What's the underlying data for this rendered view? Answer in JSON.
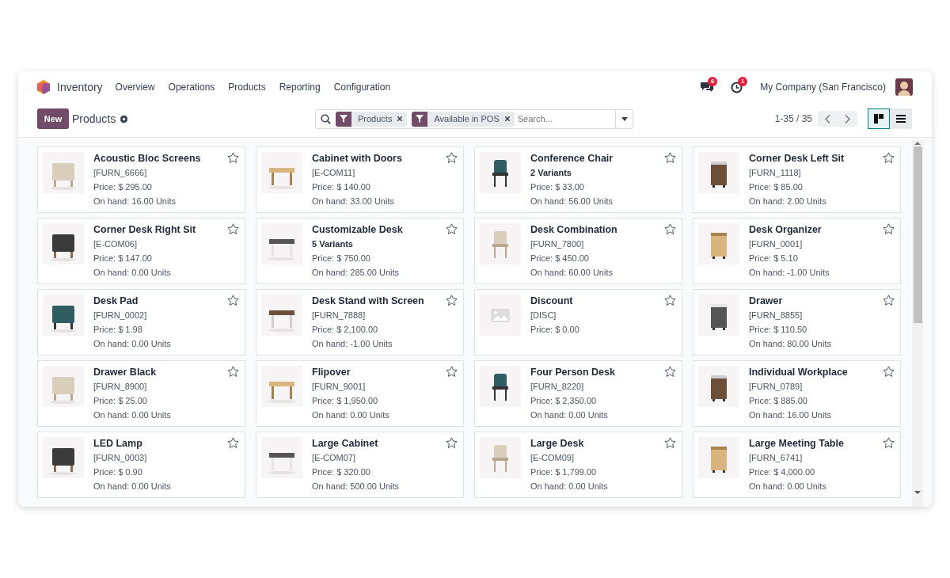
{
  "navbar": {
    "app_name": "Inventory",
    "menu": [
      "Overview",
      "Operations",
      "Products",
      "Reporting",
      "Configuration"
    ],
    "messages_count": "6",
    "activities_count": "1",
    "company": "My Company (San Francisco)"
  },
  "control_panel": {
    "new_button": "New",
    "title": "Products",
    "search": {
      "facets": [
        {
          "label": "Products"
        },
        {
          "label": "Available in POS"
        }
      ],
      "placeholder": "Search..."
    },
    "pager": "1-35 / 35",
    "views": [
      {
        "kind": "kanban",
        "selected": true
      },
      {
        "kind": "list",
        "selected": false
      }
    ]
  },
  "products": [
    {
      "name": "Acoustic Bloc Screens",
      "subtitle": {
        "kind": "reference",
        "text": "[FURN_6666]"
      },
      "price": "Price: $ 295.00",
      "on_hand": "On hand: 16.00 Units",
      "favorite": false
    },
    {
      "name": "Cabinet with Doors",
      "subtitle": {
        "kind": "reference",
        "text": "[E-COM11]"
      },
      "price": "Price: $ 140.00",
      "on_hand": "On hand: 33.00 Units",
      "favorite": false
    },
    {
      "name": "Conference Chair",
      "subtitle": {
        "kind": "variants",
        "text": "2 Variants"
      },
      "price": "Price: $ 33.00",
      "on_hand": "On hand: 56.00 Units",
      "favorite": false
    },
    {
      "name": "Corner Desk Left Sit",
      "subtitle": {
        "kind": "reference",
        "text": "[FURN_1118]"
      },
      "price": "Price: $ 85.00",
      "on_hand": "On hand: 2.00 Units",
      "favorite": false
    },
    {
      "name": "Corner Desk Right Sit",
      "subtitle": {
        "kind": "reference",
        "text": "[E-COM06]"
      },
      "price": "Price: $ 147.00",
      "on_hand": "On hand: 0.00 Units",
      "favorite": false
    },
    {
      "name": "Customizable Desk",
      "subtitle": {
        "kind": "variants",
        "text": "5 Variants"
      },
      "price": "Price: $ 750.00",
      "on_hand": "On hand: 285.00 Units",
      "favorite": false
    },
    {
      "name": "Desk Combination",
      "subtitle": {
        "kind": "reference",
        "text": "[FURN_7800]"
      },
      "price": "Price: $ 450.00",
      "on_hand": "On hand: 60.00 Units",
      "favorite": false
    },
    {
      "name": "Desk Organizer",
      "subtitle": {
        "kind": "reference",
        "text": "[FURN_0001]"
      },
      "price": "Price: $ 5.10",
      "on_hand": "On hand: -1.00 Units",
      "favorite": false
    },
    {
      "name": "Desk Pad",
      "subtitle": {
        "kind": "reference",
        "text": "[FURN_0002]"
      },
      "price": "Price: $ 1.98",
      "on_hand": "On hand: 0.00 Units",
      "favorite": false
    },
    {
      "name": "Desk Stand with Screen",
      "subtitle": {
        "kind": "reference",
        "text": "[FURN_7888]"
      },
      "price": "Price: $ 2,100.00",
      "on_hand": "On hand: -1.00 Units",
      "favorite": false
    },
    {
      "name": "Discount",
      "subtitle": {
        "kind": "reference",
        "text": "[DISC]"
      },
      "price": "Price: $ 0.00",
      "favorite": false,
      "image": {
        "kind": "placeholder"
      }
    },
    {
      "name": "Drawer",
      "subtitle": {
        "kind": "reference",
        "text": "[FURN_8855]"
      },
      "price": "Price: $ 110.50",
      "on_hand": "On hand: 80.00 Units",
      "favorite": false
    },
    {
      "name": "Drawer Black",
      "subtitle": {
        "kind": "reference",
        "text": "[FURN_8900]"
      },
      "price": "Price: $ 25.00",
      "on_hand": "On hand: 0.00 Units",
      "favorite": false
    },
    {
      "name": "Flipover",
      "subtitle": {
        "kind": "reference",
        "text": "[FURN_9001]"
      },
      "price": "Price: $ 1,950.00",
      "on_hand": "On hand: 0.00 Units",
      "favorite": false
    },
    {
      "name": "Four Person Desk",
      "subtitle": {
        "kind": "reference",
        "text": "[FURN_8220]"
      },
      "price": "Price: $ 2,350.00",
      "on_hand": "On hand: 0.00 Units",
      "favorite": false
    },
    {
      "name": "Individual Workplace",
      "subtitle": {
        "kind": "reference",
        "text": "[FURN_0789]"
      },
      "price": "Price: $ 885.00",
      "on_hand": "On hand: 16.00 Units",
      "favorite": false
    },
    {
      "name": "LED Lamp",
      "subtitle": {
        "kind": "reference",
        "text": "[FURN_0003]"
      },
      "price": "Price: $ 0.90",
      "on_hand": "On hand: 0.00 Units",
      "favorite": false
    },
    {
      "name": "Large Cabinet",
      "subtitle": {
        "kind": "reference",
        "text": "[E-COM07]"
      },
      "price": "Price: $ 320.00",
      "on_hand": "On hand: 500.00 Units",
      "favorite": false
    },
    {
      "name": "Large Desk",
      "subtitle": {
        "kind": "reference",
        "text": "[E-COM09]"
      },
      "price": "Price: $ 1,799.00",
      "on_hand": "On hand: 0.00 Units",
      "favorite": false
    },
    {
      "name": "Large Meeting Table",
      "subtitle": {
        "kind": "reference",
        "text": "[FURN_6741]"
      },
      "price": "Price: $ 4,000.00",
      "on_hand": "On hand: 0.00 Units",
      "favorite": false
    }
  ]
}
